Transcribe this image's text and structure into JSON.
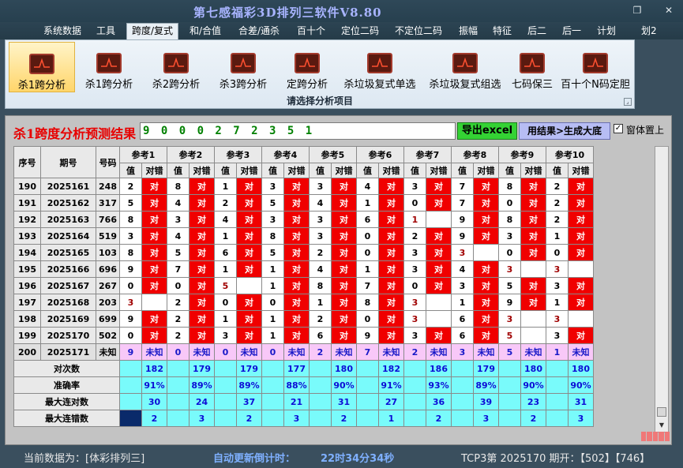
{
  "window": {
    "title": "第七感福彩3D排列三软件V8.80",
    "restore": "❐",
    "close": "✕"
  },
  "menu": [
    "系统数据",
    "工具",
    "跨度/复式",
    "和/合值",
    "合差/通杀",
    "百十个",
    "定位二码",
    "不定位二码",
    "振幅",
    "特征",
    "后二",
    "后一",
    "计划",
    "划2"
  ],
  "ribbon": {
    "buttons": [
      "杀1跨分析",
      "杀1跨分析",
      "杀2跨分析",
      "杀3跨分析",
      "定跨分析",
      "杀垃圾复式单选",
      "杀垃圾复式组选",
      "七码保三",
      "百十个N码定胆"
    ],
    "caption": "请选择分析项目",
    "launcher": "⌟"
  },
  "panel": {
    "result_title": "杀1跨度分析预测结果",
    "result_value": "9 0 0 0 2 7 2 3 5 1",
    "excel_button": "导出excel",
    "generate_button": "用结果>生成大底",
    "ontop_label": "窗体置上",
    "ontop_mark": "✓"
  },
  "table": {
    "head_seq": "序号",
    "head_issue": "期号",
    "head_code": "号码",
    "refs": [
      "参考1",
      "参考2",
      "参考3",
      "参考4",
      "参考5",
      "参考6",
      "参考7",
      "参考8",
      "参考9",
      "参考10"
    ],
    "sub_val": "值",
    "sub_res": "对错",
    "rows": [
      {
        "seq": "190",
        "issue": "2025161",
        "code": "248",
        "v": [
          "2",
          "8",
          "1",
          "3",
          "3",
          "4",
          "3",
          "7",
          "8",
          "2"
        ],
        "r": [
          "对",
          "对",
          "对",
          "对",
          "对",
          "对",
          "对",
          "对",
          "对",
          "对"
        ]
      },
      {
        "seq": "191",
        "issue": "2025162",
        "code": "317",
        "v": [
          "5",
          "4",
          "2",
          "5",
          "4",
          "1",
          "0",
          "7",
          "0",
          "2"
        ],
        "r": [
          "对",
          "对",
          "对",
          "对",
          "对",
          "对",
          "对",
          "对",
          "对",
          "对"
        ]
      },
      {
        "seq": "192",
        "issue": "2025163",
        "code": "766",
        "v": [
          "8",
          "3",
          "4",
          "3",
          "3",
          "6",
          "1",
          "9",
          "8",
          "2"
        ],
        "r": [
          "对",
          "对",
          "对",
          "对",
          "对",
          "对",
          "",
          "对",
          "对",
          "对"
        ]
      },
      {
        "seq": "193",
        "issue": "2025164",
        "code": "519",
        "v": [
          "3",
          "4",
          "1",
          "8",
          "3",
          "0",
          "2",
          "9",
          "3",
          "1"
        ],
        "r": [
          "对",
          "对",
          "对",
          "对",
          "对",
          "对",
          "对",
          "对",
          "对",
          "对"
        ]
      },
      {
        "seq": "194",
        "issue": "2025165",
        "code": "103",
        "v": [
          "8",
          "5",
          "6",
          "5",
          "2",
          "0",
          "3",
          "3",
          "0",
          "0"
        ],
        "r": [
          "对",
          "对",
          "对",
          "对",
          "对",
          "对",
          "对",
          "",
          "对",
          "对"
        ]
      },
      {
        "seq": "195",
        "issue": "2025166",
        "code": "696",
        "v": [
          "9",
          "7",
          "1",
          "1",
          "4",
          "1",
          "3",
          "4",
          "3",
          "3"
        ],
        "r": [
          "对",
          "对",
          "对",
          "对",
          "对",
          "对",
          "对",
          "对",
          "",
          ""
        ]
      },
      {
        "seq": "196",
        "issue": "2025167",
        "code": "267",
        "v": [
          "0",
          "0",
          "5",
          "1",
          "8",
          "7",
          "0",
          "3",
          "5",
          "3"
        ],
        "r": [
          "对",
          "对",
          "",
          "对",
          "对",
          "对",
          "对",
          "对",
          "对",
          "对"
        ]
      },
      {
        "seq": "197",
        "issue": "2025168",
        "code": "203",
        "v": [
          "3",
          "2",
          "0",
          "0",
          "1",
          "8",
          "3",
          "1",
          "9",
          "1"
        ],
        "r": [
          "",
          "对",
          "对",
          "对",
          "对",
          "对",
          "",
          "对",
          "对",
          "对"
        ]
      },
      {
        "seq": "198",
        "issue": "2025169",
        "code": "699",
        "v": [
          "9",
          "2",
          "1",
          "1",
          "2",
          "0",
          "3",
          "6",
          "3",
          "3"
        ],
        "r": [
          "对",
          "对",
          "对",
          "对",
          "对",
          "对",
          "",
          "对",
          "",
          ""
        ]
      },
      {
        "seq": "199",
        "issue": "2025170",
        "code": "502",
        "v": [
          "0",
          "2",
          "3",
          "1",
          "6",
          "9",
          "3",
          "6",
          "5",
          "3"
        ],
        "r": [
          "对",
          "对",
          "对",
          "对",
          "对",
          "对",
          "对",
          "对",
          "",
          "对"
        ]
      }
    ],
    "predict": {
      "seq": "200",
      "issue": "2025171",
      "code": "未知",
      "v": [
        "9",
        "0",
        "0",
        "0",
        "2",
        "7",
        "2",
        "3",
        "5",
        "1"
      ],
      "r": "未知"
    },
    "stats": {
      "label_hits": "对次数",
      "hits": [
        "182",
        "179",
        "179",
        "177",
        "180",
        "182",
        "186",
        "179",
        "180",
        "180"
      ],
      "label_acc": "准确率",
      "acc": [
        "91%",
        "89%",
        "89%",
        "88%",
        "90%",
        "91%",
        "93%",
        "89%",
        "90%",
        "90%"
      ],
      "label_maxhit": "最大连对数",
      "maxhit": [
        "30",
        "24",
        "37",
        "21",
        "31",
        "27",
        "36",
        "39",
        "23",
        "31"
      ],
      "label_maxmiss": "最大连错数",
      "maxmiss": [
        "2",
        "3",
        "2",
        "3",
        "2",
        "1",
        "2",
        "3",
        "2",
        "3"
      ]
    }
  },
  "status": {
    "data_label": "当前数据为：[体彩排列三]",
    "countdown_label": "自动更新倒计时：",
    "countdown_value": "22时34分34秒",
    "tcp_info": "TCP3第 2025170 期开：【502】【746】"
  }
}
